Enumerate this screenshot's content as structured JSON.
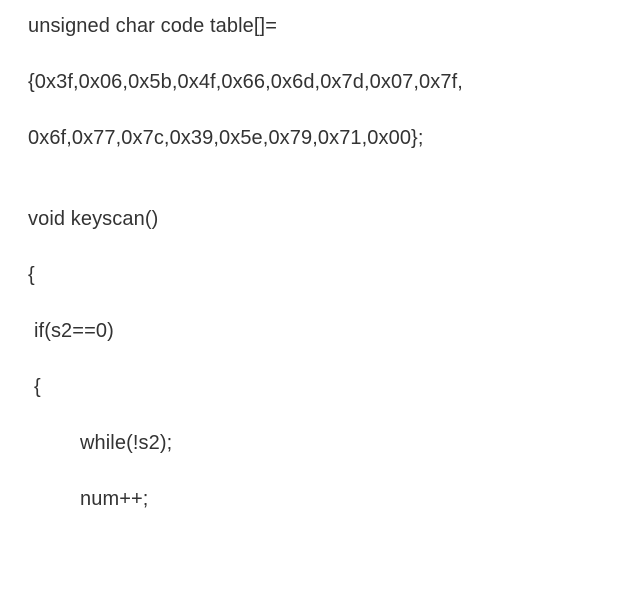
{
  "code": {
    "line1": "unsigned char code table[]=",
    "line2": "{0x3f,0x06,0x5b,0x4f,0x66,0x6d,0x7d,0x07,0x7f,",
    "line3": "0x6f,0x77,0x7c,0x39,0x5e,0x79,0x71,0x00};",
    "line4": "void keyscan()",
    "line5": "{",
    "line6": "if(s2==0)",
    "line7": "{",
    "line8": "while(!s2);",
    "line9": "num++;"
  }
}
